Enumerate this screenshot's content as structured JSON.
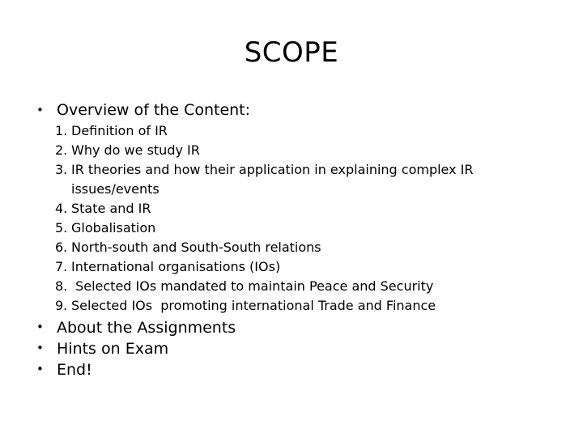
{
  "slide": {
    "title": "SCOPE",
    "bullet_marker": "•",
    "sections": [
      {
        "marker": "•",
        "text": "Overview of the Content:",
        "sub_items": [
          {
            "number": "1.",
            "text": "Definition of IR"
          },
          {
            "number": "2.",
            "text": "Why do we study IR"
          },
          {
            "number": "3.",
            "text": "IR theories and how their application in explaining complex IR issues/events"
          },
          {
            "number": "4.",
            "text": "State and IR"
          },
          {
            "number": "5.",
            "text": "Globalisation"
          },
          {
            "number": "6.",
            "text": "North-south and South-South relations"
          },
          {
            "number": "7.",
            "text": "International organisations (IOs)"
          },
          {
            "number": "8.",
            "text": " Selected IOs mandated to maintain Peace and Security"
          },
          {
            "number": "9.",
            "text": "Selected IOs  promoting international Trade and Finance"
          }
        ]
      }
    ],
    "tail_bullets": [
      {
        "marker": "•",
        "text": "About the Assignments"
      },
      {
        "marker": "•",
        "text": "Hints on Exam"
      },
      {
        "marker": "•",
        "text": "End!"
      }
    ],
    "colors": {
      "background": "#ffffff",
      "text": "#000000"
    }
  }
}
